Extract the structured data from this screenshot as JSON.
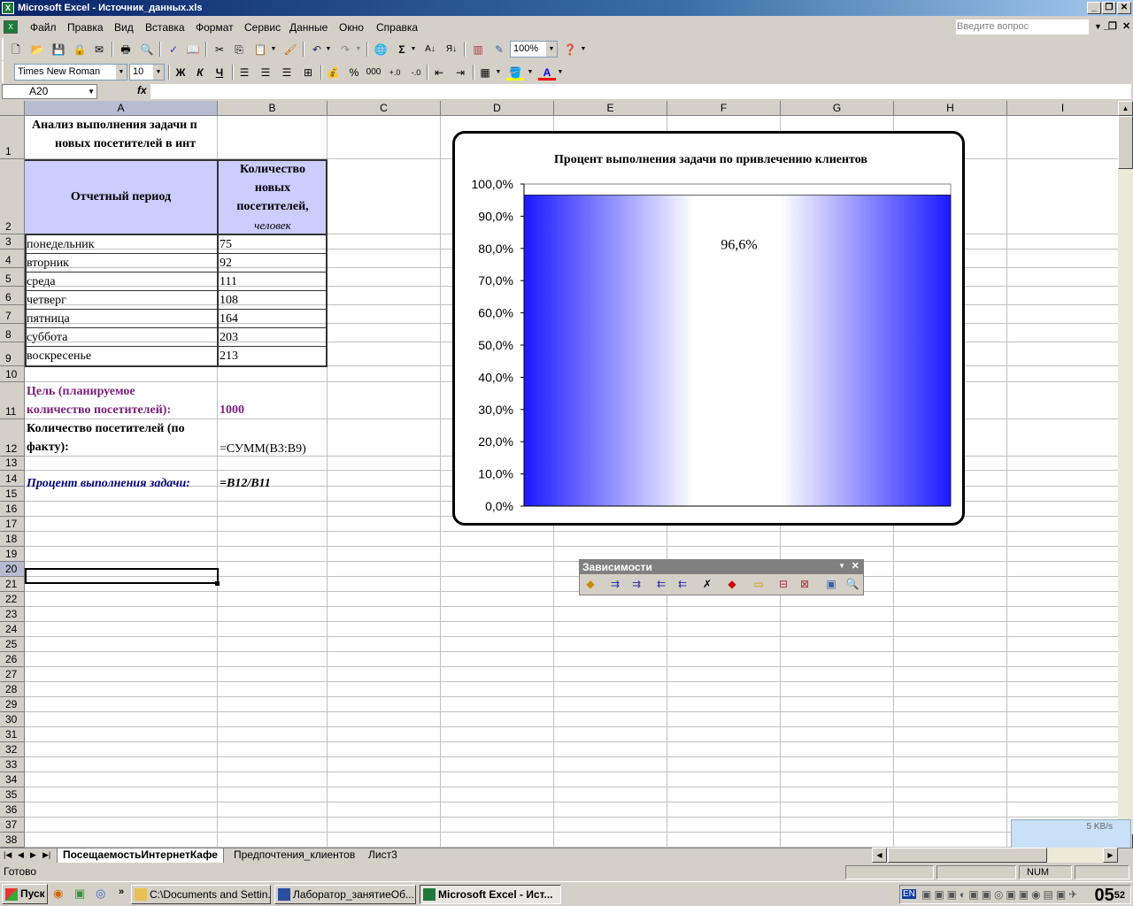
{
  "window": {
    "title": "Microsoft Excel - Источник_данных.xls"
  },
  "menu": {
    "items": [
      "Файл",
      "Правка",
      "Вид",
      "Вставка",
      "Формат",
      "Сервис",
      "Данные",
      "Окно",
      "Справка"
    ],
    "ask_placeholder": "Введите вопрос"
  },
  "toolbar": {
    "zoom": "100%",
    "font_name": "Times New Roman",
    "font_size": "10",
    "bold": "Ж",
    "italic": "К",
    "underline": "Ч",
    "percent": "%",
    "thousands": "000"
  },
  "formula_bar": {
    "name_box": "A20",
    "fx": "fx",
    "formula": ""
  },
  "columns": [
    "A",
    "B",
    "C",
    "D",
    "E",
    "F",
    "G",
    "H",
    "I"
  ],
  "rows": [
    "1",
    "2",
    "3",
    "4",
    "5",
    "6",
    "7",
    "8",
    "9",
    "10",
    "11",
    "12",
    "13",
    "14",
    "15",
    "16",
    "17",
    "18",
    "19",
    "20",
    "21",
    "22",
    "23",
    "24",
    "25",
    "26",
    "27",
    "28",
    "29",
    "30",
    "31",
    "32",
    "33",
    "34",
    "35",
    "36",
    "37",
    "38"
  ],
  "cells": {
    "a1_line1": "Анализ выполнения задачи п",
    "a1_line2": "новых посетителей в инт",
    "a2": "Отчетный период",
    "b2_line1": "Количество",
    "b2_line2": "новых",
    "b2_line3": "посетителей,",
    "b2_line4": "человек",
    "days": [
      "понедельник",
      "вторник",
      "среда",
      "четверг",
      "пятница",
      "суббота",
      "воскресенье"
    ],
    "counts": [
      "75",
      "92",
      "111",
      "108",
      "164",
      "203",
      "213"
    ],
    "a11_line1": "Цель (планируемое",
    "a11_line2": "количество посетителей):",
    "b11": "1000",
    "a12_line1": "Количество посетителей (по",
    "a12_line2": "факту):",
    "b12": "=СУММ(B3:B9)",
    "a14": "Процент выполнения задачи:",
    "b14": "=B12/B11"
  },
  "chart_data": {
    "type": "bar",
    "title": "Процент выполнения задачи по привлечению клиентов",
    "categories": [
      ""
    ],
    "values": [
      96.6
    ],
    "data_label": "96,6%",
    "ylim": [
      0,
      100
    ],
    "y_ticks": [
      "0,0%",
      "10,0%",
      "20,0%",
      "30,0%",
      "40,0%",
      "50,0%",
      "60,0%",
      "70,0%",
      "80,0%",
      "90,0%",
      "100,0%"
    ],
    "grid": false,
    "bar_fill": "gradient-blue-white-blue",
    "colors": {
      "bar_edge": "#1a1aff",
      "bar_center": "#ffffff"
    }
  },
  "dependency_toolbar": {
    "title": "Зависимости"
  },
  "sheet_tabs": [
    "ПосещаемостьИнтернетКафе",
    "Предпочтения_клиентов",
    "Лист3"
  ],
  "status": {
    "left": "Готово",
    "num": "NUM"
  },
  "taskbar": {
    "start": "Пуск",
    "tasks": [
      "C:\\Documents and Settin...",
      "Лаборатор_занятиеОб...",
      "Microsoft Excel - Ист..."
    ],
    "lang": "EN",
    "clock": "05",
    "clock_min": "52",
    "net_speed": "5 KB/s"
  }
}
